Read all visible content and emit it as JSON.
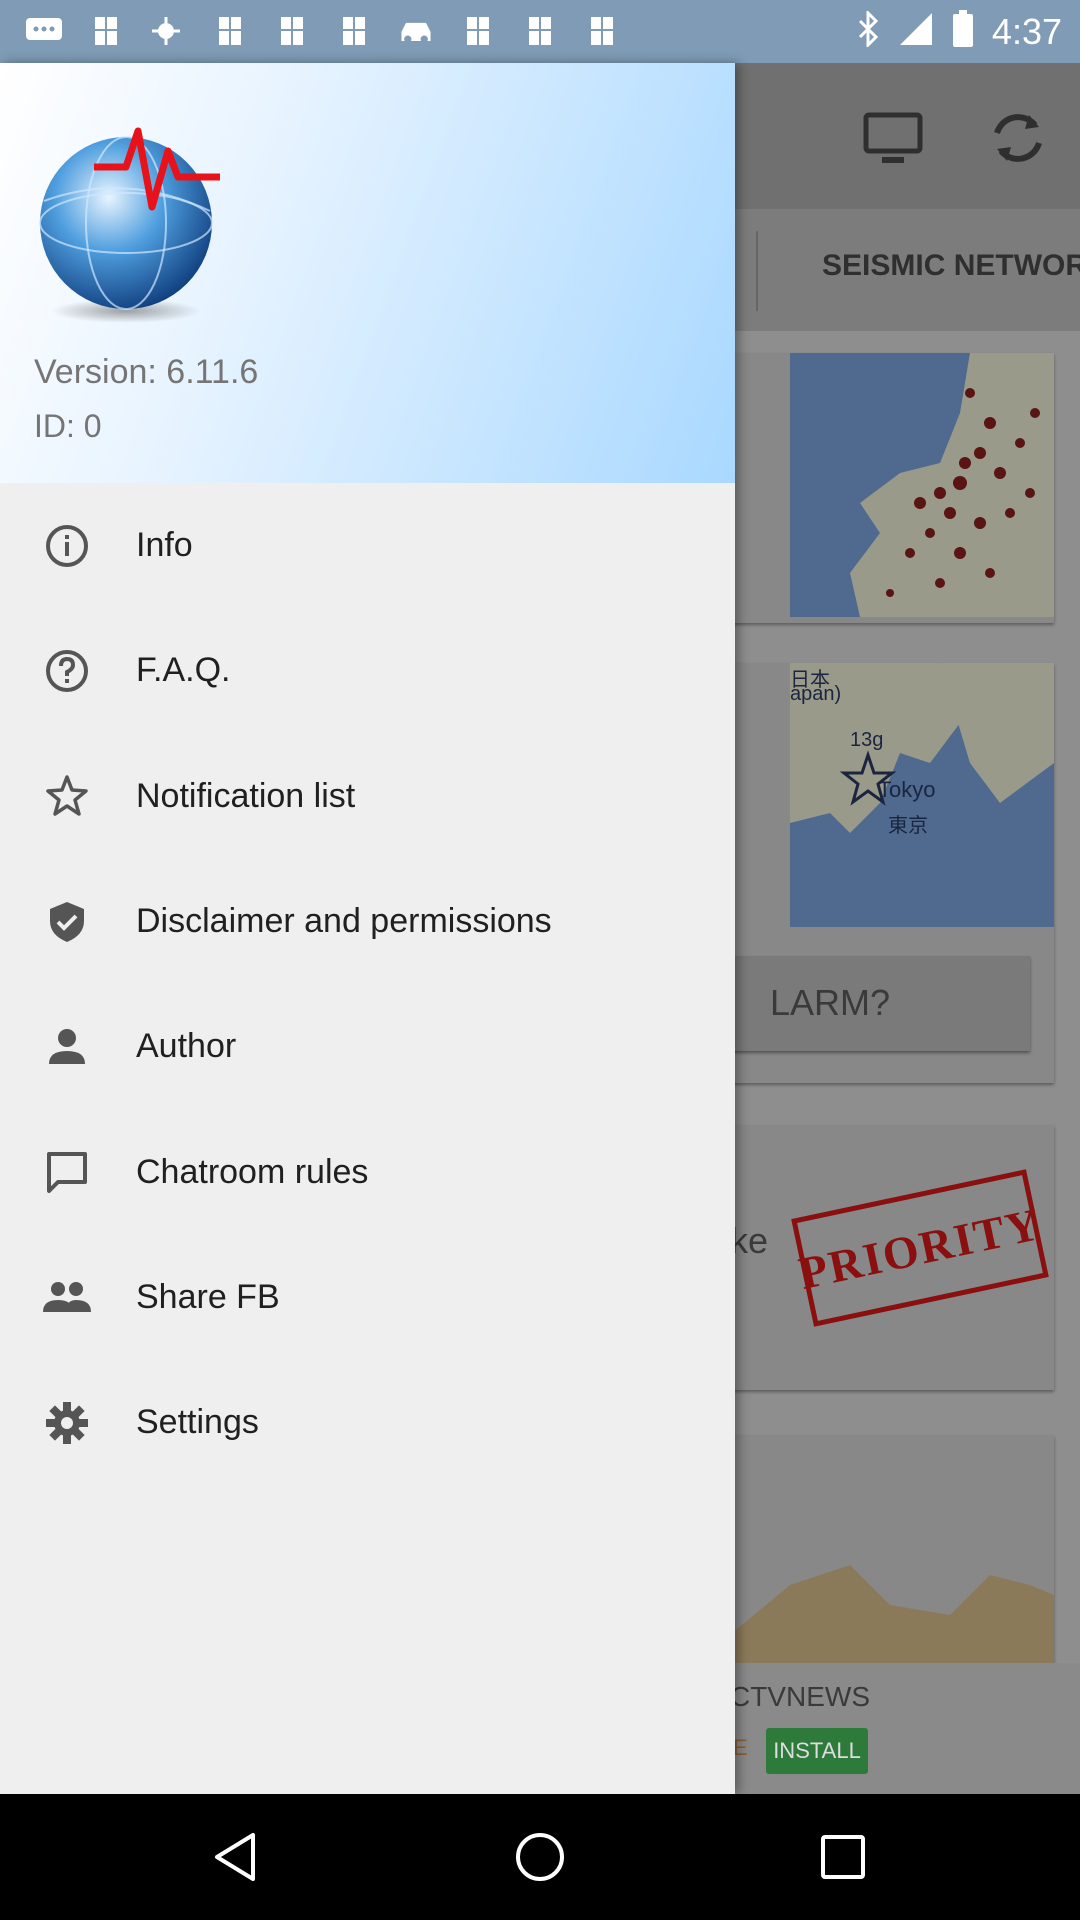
{
  "status_bar": {
    "time": "4:37",
    "left_icons": [
      "chat-icon",
      "image-icon",
      "weather-icon",
      "image-icon",
      "image-icon",
      "image-icon",
      "car-icon",
      "image-icon",
      "image-icon",
      "image-icon"
    ],
    "right_icons": [
      "bluetooth-icon",
      "signal-icon",
      "battery-icon"
    ]
  },
  "background_app": {
    "toolbar_icons": [
      "monitor-icon",
      "refresh-icon"
    ],
    "tab_label": "SEISMIC NETWOR",
    "map2_labels": {
      "l1": "日本",
      "l2": "apan)",
      "l3": "13g",
      "l4": "Tokyo",
      "l5": "東京"
    },
    "alarm_button_text": "LARM?",
    "card_text_partial": "ke",
    "priority_stamp": "PRIORITY",
    "ad_name": "CTVNEWS",
    "ad_free_fragment": "E",
    "ad_install": "INSTALL"
  },
  "drawer": {
    "version": "Version: 6.11.6",
    "id": "ID: 0",
    "menu": [
      {
        "label": "Info",
        "icon": "info-icon"
      },
      {
        "label": "F.A.Q.",
        "icon": "help-circle-icon"
      },
      {
        "label": "Notification list",
        "icon": "star-icon"
      },
      {
        "label": "Disclaimer and permissions",
        "icon": "shield-check-icon"
      },
      {
        "label": "Author",
        "icon": "person-icon"
      },
      {
        "label": "Chatroom rules",
        "icon": "chat-bubble-icon"
      },
      {
        "label": "Share FB",
        "icon": "people-icon"
      },
      {
        "label": "Settings",
        "icon": "gear-icon"
      }
    ]
  },
  "nav_bar": [
    "back-icon",
    "home-icon",
    "recents-icon"
  ]
}
